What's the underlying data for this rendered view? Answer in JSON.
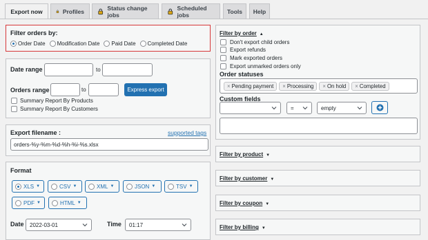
{
  "tabs": [
    {
      "label": "Export now",
      "active": true
    },
    {
      "label": "Profiles",
      "locked": true
    },
    {
      "label": "Status change jobs",
      "locked": true
    },
    {
      "label": "Scheduled jobs",
      "locked": true
    },
    {
      "label": "Tools"
    },
    {
      "label": "Help"
    }
  ],
  "filter_orders": {
    "title": "Filter orders by:",
    "options": [
      "Order Date",
      "Modification Date",
      "Paid Date",
      "Completed Date"
    ],
    "selected": "Order Date"
  },
  "date_range": {
    "label": "Date range",
    "to": "to"
  },
  "orders_range": {
    "label": "Orders range",
    "to": "to",
    "button": "Express export"
  },
  "summary": {
    "products": "Summary Report By Products",
    "customers": "Summary Report By Customers"
  },
  "export_filename": {
    "label": "Export filename :",
    "link": "supported tags",
    "value": "orders-%y-%m-%d-%h-%i-%s.xlsx"
  },
  "format": {
    "label": "Format",
    "options": [
      "XLS",
      "CSV",
      "XML",
      "JSON",
      "TSV",
      "PDF",
      "HTML"
    ],
    "selected": "XLS"
  },
  "date_field": {
    "label": "Date",
    "value": "2022-03-01"
  },
  "time_field": {
    "label": "Time",
    "value": "01:17"
  },
  "filter_by_order": {
    "title": "Filter by order",
    "checkboxes": [
      "Don't export child orders",
      "Export refunds",
      "Mark exported orders",
      "Export unmarked orders only"
    ],
    "statuses_label": "Order statuses",
    "statuses": [
      "Pending payment",
      "Processing",
      "On hold",
      "Completed"
    ],
    "custom_fields_label": "Custom fields",
    "operator": "=",
    "value_select": "empty"
  },
  "sections": [
    "Filter by product",
    "Filter by customer",
    "Filter by coupon",
    "Filter by billing"
  ],
  "colors": {
    "accent": "#2271b1",
    "highlight": "#d63638"
  }
}
